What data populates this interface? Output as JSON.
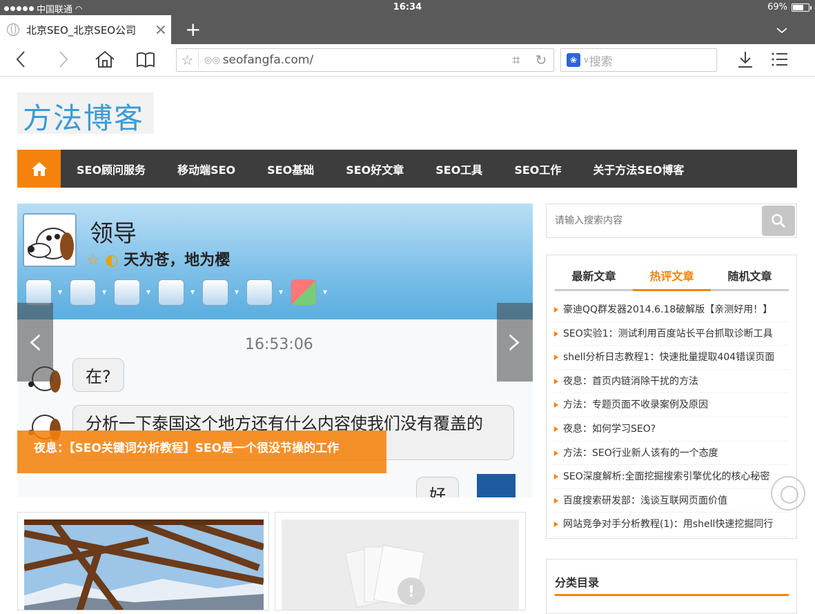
{
  "status": {
    "carrier": "中国联通",
    "time": "16:34",
    "battery": "69%",
    "battery_level": 0.69
  },
  "browser": {
    "tab_title": "北京SEO_北京SEO公司",
    "close": "×",
    "new_tab": "+",
    "url": "seofangfa.com/",
    "search_placeholder": "搜索",
    "paw": "❀"
  },
  "site": {
    "logo": "方法博客",
    "nav": [
      "SEO顾问服务",
      "移动端SEO",
      "SEO基础",
      "SEO好文章",
      "SEO工具",
      "SEO工作",
      "关于方法SEO博客"
    ]
  },
  "slider": {
    "qq_name": "领导",
    "qq_status": "天为苍，地为樱",
    "qq_stars": "☆ ◐",
    "chat_time": "16:53:06",
    "msg1": "在?",
    "msg2": "分析一下泰国这个地方还有什么内容使我们没有覆盖的",
    "msg3": "好",
    "caption": "夜息：【SEO关键词分析教程】SEO是一个很没节操的工作",
    "prev": "‹",
    "next": "›"
  },
  "sidebar": {
    "search_placeholder": "请输入搜索内容",
    "tabs": [
      {
        "label": "最新文章",
        "active": false
      },
      {
        "label": "热评文章",
        "active": true
      },
      {
        "label": "随机文章",
        "active": false
      }
    ],
    "articles": [
      "豪迪QQ群发器2014.6.18破解版【亲测好用！】",
      "SEO实验1：测试利用百度站长平台抓取诊断工具",
      "shell分析日志教程1：快速批量提取404错误页面",
      "夜息：首页内链消除干扰的方法",
      "方法：专题页面不收录案例及原因",
      "夜息：如何学习SEO?",
      "方法：SEO行业新人该有的一个态度",
      "SEO深度解析:全面挖掘搜索引擎优化的核心秘密",
      "百度搜索研发部：浅谈互联网页面价值",
      "网站竞争对手分析教程(1)：用shell快速挖掘同行"
    ],
    "category_title": "分类目录"
  },
  "colors": {
    "accent": "#f5820c",
    "nav_bg": "#3d3d3d",
    "logo": "#3a9bd6"
  }
}
